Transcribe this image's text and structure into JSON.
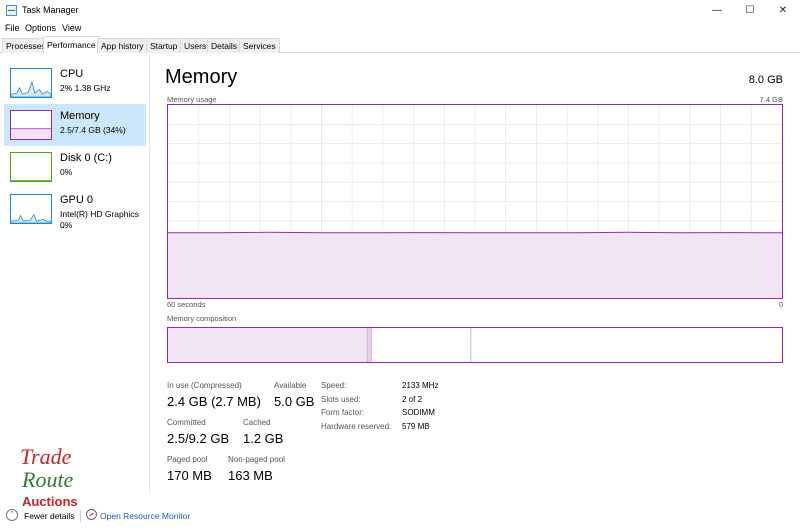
{
  "window": {
    "title": "Task Manager",
    "minimize_glyph": "—",
    "maximize_glyph": "☐",
    "close_glyph": "✕"
  },
  "menu": [
    "File",
    "Options",
    "View"
  ],
  "tabs": [
    "Processes",
    "Performance",
    "App history",
    "Startup",
    "Users",
    "Details",
    "Services"
  ],
  "active_tab": "Performance",
  "sidebar": {
    "items": [
      {
        "name": "CPU",
        "lines": [
          "2% 1.38 GHz"
        ],
        "color": "#1c8ad8",
        "icon": "cpu-usage-thumbnail"
      },
      {
        "name": "Memory",
        "lines": [
          "2.5/7.4 GB (34%)"
        ],
        "color": "#9528b4",
        "icon": "memory-usage-thumbnail",
        "selected": true
      },
      {
        "name": "Disk 0 (C:)",
        "lines": [
          "0%"
        ],
        "color": "#4da60c",
        "icon": "disk-usage-thumbnail"
      },
      {
        "name": "GPU 0",
        "lines": [
          "Intel(R) HD Graphics ...",
          "0%"
        ],
        "color": "#1c8ad8",
        "icon": "gpu-usage-thumbnail"
      }
    ]
  },
  "main": {
    "title": "Memory",
    "total": "8.0 GB",
    "usage_label": "Memory usage",
    "usage_max": "7.4 GB",
    "time_left": "60 seconds",
    "time_right": "0",
    "composition_label": "Memory composition",
    "stats": {
      "in_use_label": "In use (Compressed)",
      "in_use_value": "2.4 GB (2.7 MB)",
      "available_label": "Available",
      "available_value": "5.0 GB",
      "committed_label": "Committed",
      "committed_value": "2.5/9.2 GB",
      "cached_label": "Cached",
      "cached_value": "1.2 GB",
      "paged_label": "Paged pool",
      "paged_value": "170 MB",
      "nonpaged_label": "Non-paged pool",
      "nonpaged_value": "163 MB"
    },
    "specs": [
      {
        "label": "Speed:",
        "value": "2133 MHz"
      },
      {
        "label": "Slots used:",
        "value": "2 of 2"
      },
      {
        "label": "Form factor:",
        "value": "SODIMM"
      },
      {
        "label": "Hardware reserved:",
        "value": "579 MB"
      }
    ]
  },
  "footer": {
    "fewer_details": "Fewer details",
    "open_resource_monitor": "Open Resource Monitor",
    "chevron_glyph": "⌃"
  },
  "chart_data": {
    "type": "area",
    "xlabel": "",
    "ylabel": "Memory usage",
    "xlim": [
      60,
      0
    ],
    "ylim": [
      0,
      7.4
    ],
    "x": [
      60,
      55,
      50,
      45,
      40,
      35,
      30,
      25,
      20,
      15,
      10,
      5,
      0
    ],
    "series": [
      {
        "values": [
          2.5,
          2.5,
          2.52,
          2.5,
          2.5,
          2.51,
          2.5,
          2.5,
          2.5,
          2.52,
          2.5,
          2.51,
          2.5
        ]
      }
    ],
    "composition_gb": {
      "in_use": 2.4,
      "modified": 0.05,
      "standby": 1.2,
      "free": 3.75
    },
    "grid": true,
    "color": "#9528b4"
  },
  "watermark": {
    "line1": "Trade",
    "line2": "Route",
    "line3": "Auctions"
  }
}
